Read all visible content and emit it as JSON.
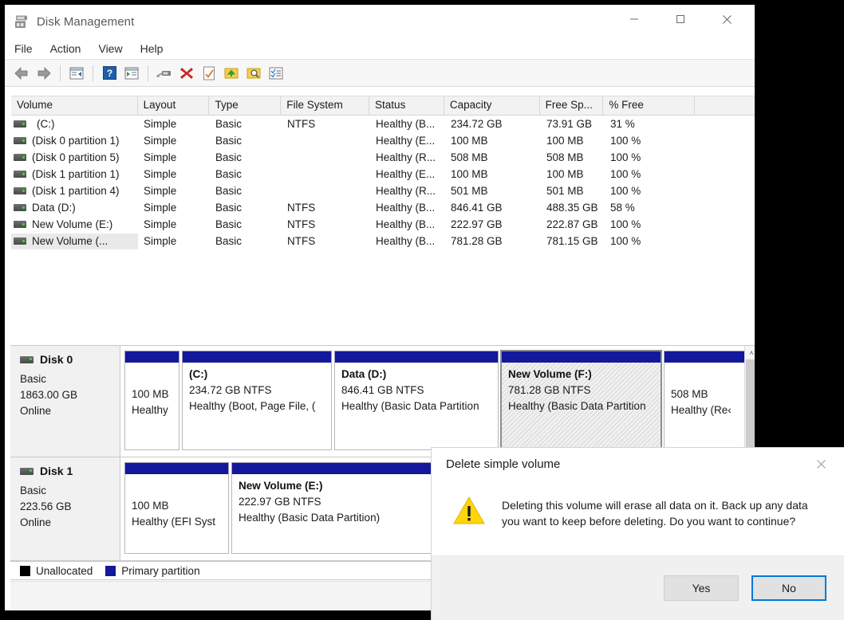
{
  "window": {
    "title": "Disk Management",
    "icon": "disk-drive-icon",
    "controls": {
      "minimize": "—",
      "maximize": "□",
      "close": "✕"
    }
  },
  "menu": {
    "items": [
      "File",
      "Action",
      "View",
      "Help"
    ]
  },
  "toolbar": {
    "buttons": [
      {
        "name": "back-button",
        "icon": "arrow-left-icon"
      },
      {
        "name": "forward-button",
        "icon": "arrow-right-icon"
      },
      {
        "name": "show-hide-console-tree-button",
        "icon": "console-tree-icon"
      },
      {
        "name": "help-button",
        "icon": "question-mark-icon"
      },
      {
        "name": "show-hide-action-pane-button",
        "icon": "action-pane-icon"
      },
      {
        "name": "rescan-disks-button",
        "icon": "disk-icon"
      },
      {
        "name": "delete-volume-button",
        "icon": "red-x-icon"
      },
      {
        "name": "properties-button",
        "icon": "checked-page-icon"
      },
      {
        "name": "export-list-button",
        "icon": "yellow-folder-up-icon"
      },
      {
        "name": "search-button",
        "icon": "folder-magnifier-icon"
      },
      {
        "name": "all-tasks-button",
        "icon": "checklist-icon"
      }
    ]
  },
  "volume_list": {
    "columns": [
      "Volume",
      "Layout",
      "Type",
      "File System",
      "Status",
      "Capacity",
      "Free Sp...",
      "% Free",
      ""
    ],
    "rows": [
      {
        "volume": "(C:)",
        "indent": true,
        "layout": "Simple",
        "type": "Basic",
        "fs": "NTFS",
        "status": "Healthy (B...",
        "capacity": "234.72 GB",
        "free": "73.91 GB",
        "pctfree": "31 %",
        "selected": false
      },
      {
        "volume": "(Disk 0 partition 1)",
        "indent": false,
        "layout": "Simple",
        "type": "Basic",
        "fs": "",
        "status": "Healthy (E...",
        "capacity": "100 MB",
        "free": "100 MB",
        "pctfree": "100 %",
        "selected": false
      },
      {
        "volume": "(Disk 0 partition 5)",
        "indent": false,
        "layout": "Simple",
        "type": "Basic",
        "fs": "",
        "status": "Healthy (R...",
        "capacity": "508 MB",
        "free": "508 MB",
        "pctfree": "100 %",
        "selected": false
      },
      {
        "volume": "(Disk 1 partition 1)",
        "indent": false,
        "layout": "Simple",
        "type": "Basic",
        "fs": "",
        "status": "Healthy (E...",
        "capacity": "100 MB",
        "free": "100 MB",
        "pctfree": "100 %",
        "selected": false
      },
      {
        "volume": "(Disk 1 partition 4)",
        "indent": false,
        "layout": "Simple",
        "type": "Basic",
        "fs": "",
        "status": "Healthy (R...",
        "capacity": "501 MB",
        "free": "501 MB",
        "pctfree": "100 %",
        "selected": false
      },
      {
        "volume": "Data (D:)",
        "indent": false,
        "layout": "Simple",
        "type": "Basic",
        "fs": "NTFS",
        "status": "Healthy (B...",
        "capacity": "846.41 GB",
        "free": "488.35 GB",
        "pctfree": "58 %",
        "selected": false
      },
      {
        "volume": "New Volume (E:)",
        "indent": false,
        "layout": "Simple",
        "type": "Basic",
        "fs": "NTFS",
        "status": "Healthy (B...",
        "capacity": "222.97 GB",
        "free": "222.87 GB",
        "pctfree": "100 %",
        "selected": false
      },
      {
        "volume": "New Volume (...",
        "indent": false,
        "layout": "Simple",
        "type": "Basic",
        "fs": "NTFS",
        "status": "Healthy (B...",
        "capacity": "781.28 GB",
        "free": "781.15 GB",
        "pctfree": "100 %",
        "selected": true
      }
    ]
  },
  "disks": [
    {
      "name": "Disk 0",
      "type": "Basic",
      "size": "1863.00 GB",
      "state": "Online",
      "partitions": [
        {
          "title": "",
          "size_fs": "100 MB",
          "status": "Healthy",
          "flex": 69,
          "selected": false
        },
        {
          "title": "(C:)",
          "size_fs": "234.72 GB NTFS",
          "status": "Healthy (Boot, Page File, (",
          "flex": 188,
          "selected": false
        },
        {
          "title": "Data  (D:)",
          "size_fs": "846.41 GB NTFS",
          "status": "Healthy (Basic Data Partition",
          "flex": 206,
          "selected": false
        },
        {
          "title": "New Volume  (F:)",
          "size_fs": "781.28 GB NTFS",
          "status": "Healthy (Basic Data Partition",
          "flex": 201,
          "selected": true
        },
        {
          "title": "",
          "size_fs": "508 MB",
          "status": "Healthy (Re‹",
          "flex": 105,
          "selected": false
        }
      ]
    },
    {
      "name": "Disk 1",
      "type": "Basic",
      "size": "223.56 GB",
      "state": "Online",
      "partitions": [
        {
          "title": "",
          "size_fs": "100 MB",
          "status": "Healthy (EFI Syst",
          "flex": 131,
          "selected": false
        },
        {
          "title": "New Volume  (E:)",
          "size_fs": "222.97 GB NTFS",
          "status": "Healthy (Basic Data Partition)",
          "flex": 254,
          "selected": false
        }
      ]
    }
  ],
  "legend": [
    {
      "label": "Unallocated",
      "color": "#000000"
    },
    {
      "label": "Primary partition",
      "color": "#14189b"
    }
  ],
  "scrollbar": {
    "up_arrow": "˄"
  },
  "dialog": {
    "title": "Delete simple volume",
    "close_icon": "✕",
    "warning_icon": "warning-triangle-icon",
    "message": "Deleting this volume will erase all data on it. Back up any data you want to keep before deleting. Do you want to continue?",
    "buttons": [
      {
        "label": "Yes",
        "name": "yes-button",
        "focused": false
      },
      {
        "label": "No",
        "name": "no-button",
        "focused": true
      }
    ]
  }
}
